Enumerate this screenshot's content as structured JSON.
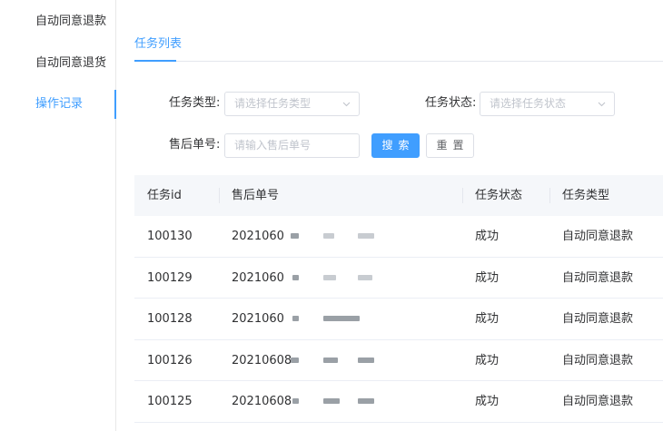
{
  "sidebar": {
    "items": [
      {
        "label": "自动同意退款",
        "active": false
      },
      {
        "label": "自动同意退货",
        "active": false
      },
      {
        "label": "操作记录",
        "active": true
      }
    ]
  },
  "tabs": [
    {
      "label": "任务列表",
      "active": true
    }
  ],
  "filters": {
    "task_type": {
      "label": "任务类型:",
      "placeholder": "请选择任务类型"
    },
    "task_status": {
      "label": "任务状态:",
      "placeholder": "请选择任务状态"
    },
    "aftersale_no": {
      "label": "售后单号:",
      "placeholder": "请输入售后单号"
    },
    "search_label": "搜索",
    "reset_label": "重置"
  },
  "table": {
    "columns": [
      "任务id",
      "售后单号",
      "任务状态",
      "任务类型"
    ],
    "rows": [
      {
        "id": "100130",
        "order": "2021060",
        "status": "成功",
        "type": "自动同意退款"
      },
      {
        "id": "100129",
        "order": "2021060",
        "status": "成功",
        "type": "自动同意退款"
      },
      {
        "id": "100128",
        "order": "2021060",
        "status": "成功",
        "type": "自动同意退款"
      },
      {
        "id": "100126",
        "order": "20210608",
        "status": "成功",
        "type": "自动同意退款"
      },
      {
        "id": "100125",
        "order": "20210608",
        "status": "成功",
        "type": "自动同意退款"
      }
    ]
  },
  "colors": {
    "accent": "#409eff",
    "border": "#dcdfe6",
    "header_bg": "#f5f7fa",
    "text": "#303133",
    "placeholder": "#c0c4cc"
  }
}
